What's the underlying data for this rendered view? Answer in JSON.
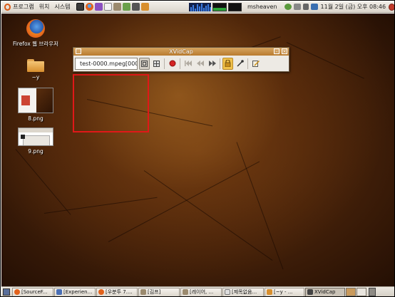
{
  "top_panel": {
    "menus": [
      "프로그램",
      "위치",
      "시스템"
    ],
    "launchers": [
      {
        "icon": "terminal-icon",
        "color": "#3a3a3a"
      },
      {
        "icon": "firefox-icon",
        "color": "#e2621c"
      },
      {
        "icon": "pidgin-icon",
        "color": "#8a4fc0"
      },
      {
        "icon": "text-editor-icon",
        "color": "#f2f2f2"
      },
      {
        "icon": "gimp-icon",
        "color": "#9b8a6e"
      },
      {
        "icon": "image-viewer-icon",
        "color": "#6aa04a"
      },
      {
        "icon": "screenshot-icon",
        "color": "#555555"
      },
      {
        "icon": "folder-icon",
        "color": "#d88f2e"
      }
    ],
    "username": "msheaven",
    "clock": "11월 2일 (금) 오후 08:46"
  },
  "desktop": {
    "icons": [
      {
        "label": "Firefox 웹 브라우저",
        "icon": "firefox-icon"
      },
      {
        "label": "~y",
        "icon": "folder-icon"
      },
      {
        "label": "8.png",
        "icon": "image-thumbnail-icon"
      },
      {
        "label": "9.png",
        "icon": "image-thumbnail-icon"
      }
    ]
  },
  "xvidcap": {
    "title": "XVidCap",
    "filename": "test-0000.mpeg[0000]",
    "buttons": [
      {
        "name": "capture-area-button",
        "icon": "frame-icon",
        "state": "pressed"
      },
      {
        "name": "filmstrip-button",
        "icon": "filmstrip-icon",
        "state": "normal"
      },
      {
        "name": "record-button",
        "icon": "record-icon",
        "state": "normal"
      },
      {
        "name": "rewind-button",
        "icon": "rewind-icon",
        "state": "disabled"
      },
      {
        "name": "back-button",
        "icon": "back-icon",
        "state": "disabled"
      },
      {
        "name": "forward-button",
        "icon": "forward-icon",
        "state": "normal"
      },
      {
        "name": "lock-button",
        "icon": "lock-icon",
        "state": "active"
      },
      {
        "name": "select-area-button",
        "icon": "eyedropper-icon",
        "state": "normal"
      },
      {
        "name": "edit-button",
        "icon": "edit-icon",
        "state": "normal"
      }
    ]
  },
  "taskbar": {
    "tasks": [
      {
        "label": "[SourceF...",
        "icon": "firefox-icon",
        "color": "#e2621c",
        "active": false
      },
      {
        "label": "[Experien...",
        "icon": "document-icon",
        "color": "#4a6fb5",
        "active": false
      },
      {
        "label": "[우분투 7....",
        "icon": "firefox-icon",
        "color": "#e2621c",
        "active": false
      },
      {
        "label": "[김프]",
        "icon": "gimp-icon",
        "color": "#9b8a6e",
        "active": false
      },
      {
        "label": "[레이어, ...",
        "icon": "gimp-icon",
        "color": "#9b8a6e",
        "active": false
      },
      {
        "label": "[제목없음...",
        "icon": "document-icon",
        "color": "#dddddd",
        "active": false
      },
      {
        "label": "[~y - ...",
        "icon": "folder-icon",
        "color": "#d88f2e",
        "active": false
      },
      {
        "label": "XVidCap",
        "icon": "xvidcap-icon",
        "color": "#444444",
        "active": true
      }
    ]
  },
  "colors": {
    "selection_border": "#e01818",
    "title_bar": "#c98e3f",
    "desktop_base": "#4a240a"
  }
}
